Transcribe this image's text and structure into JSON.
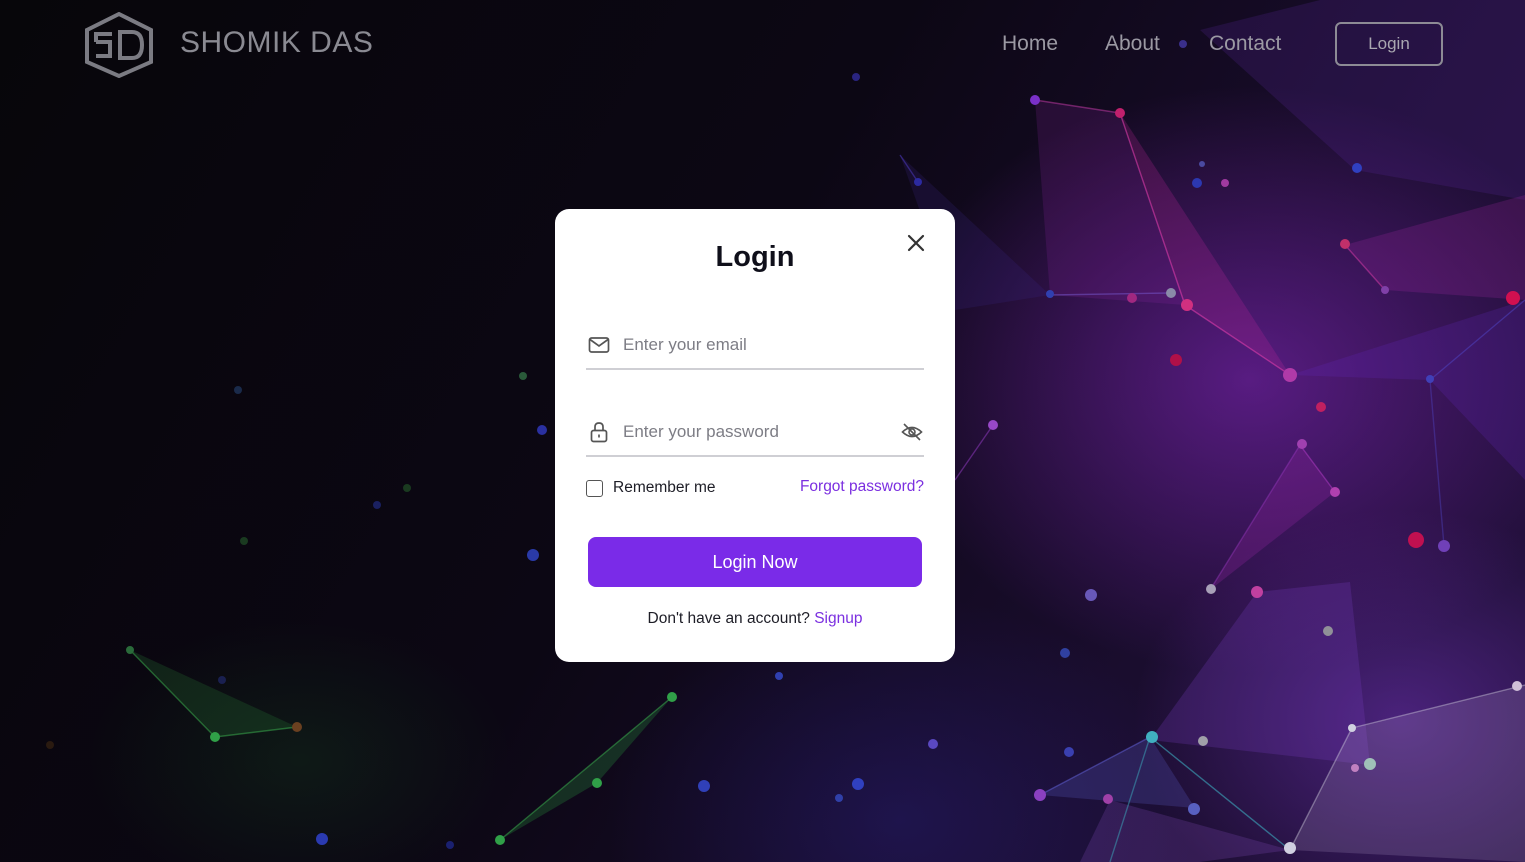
{
  "header": {
    "brand": "SHOMIK DAS",
    "logo_icon": "sd-cube-logo-icon",
    "nav": {
      "home": "Home",
      "about": "About",
      "contact": "Contact",
      "login": "Login"
    }
  },
  "modal": {
    "title": "Login",
    "close_icon": "close-icon",
    "email": {
      "icon": "mail-icon",
      "placeholder": "Enter your email",
      "value": ""
    },
    "password": {
      "icon": "lock-icon",
      "placeholder": "Enter your password",
      "value": "",
      "toggle_icon": "eye-off-icon"
    },
    "remember_label": "Remember me",
    "remember_checked": false,
    "forgot_label": "Forgot password?",
    "submit_label": "Login Now",
    "signup_prompt": "Don't have an account?",
    "signup_link": "Signup"
  },
  "colors": {
    "accent": "#7a2be8",
    "link": "#7b2fe0",
    "background": "#0a0710"
  }
}
